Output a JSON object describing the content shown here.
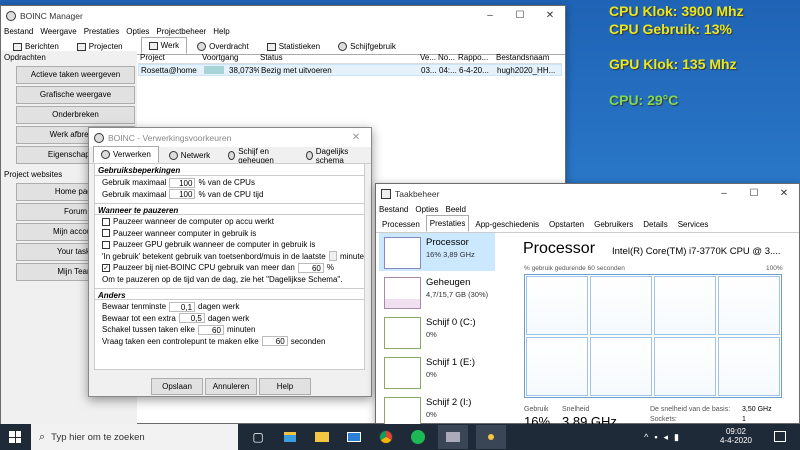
{
  "overlay": {
    "cpu_clock": "CPU Klok: 3900 Mhz",
    "cpu_usage": "CPU Gebruik: 13%",
    "gpu_clock": "GPU Klok: 135 Mhz",
    "cpu_temp": "CPU: 29°C"
  },
  "boinc": {
    "title": "BOINC Manager",
    "menu": [
      "Bestand",
      "Weergave",
      "Prestaties",
      "Opties",
      "Projectbeheer",
      "Help"
    ],
    "tabs": [
      "Berichten",
      "Projecten",
      "Werk",
      "Overdracht",
      "Statistieken",
      "Schijfgebruik"
    ],
    "side_opdrachten": "Opdrachten",
    "side_buttons": [
      "Actieve taken weergeven",
      "Grafische weergave",
      "Onderbreken",
      "Werk afbreken",
      "Eigenschappen"
    ],
    "side_projects": "Project websites",
    "side_links": [
      "Home page",
      "Forum",
      "Mijn account",
      "Your tasks",
      "Mijn Team"
    ],
    "columns": [
      "Project",
      "Voortgang",
      "Status",
      "Ve...",
      "No...",
      "Rappo...",
      "Bestandsnaam"
    ],
    "row": [
      "Rosetta@home",
      "38,073%",
      "Bezig met uitvoeren",
      "03...",
      "04:...",
      "6-4-20...",
      "hugh2020_HH..."
    ]
  },
  "prefs": {
    "title": "BOINC - Verwerkingsvoorkeuren",
    "tabs": [
      "Verwerken",
      "Netwerk",
      "Schijf en geheugen",
      "Dagelijks schema"
    ],
    "sec1": "Gebruiksbeperkingen",
    "l1a": "Gebruik maximaal",
    "v1": "100",
    "l1b": "% van de CPUs",
    "l2a": "Gebruik maximaal",
    "v2": "100",
    "l2b": "% van de CPU tijd",
    "sec2": "Wanneer te pauzeren",
    "c1": "Pauzeer wanneer de computer op accu werkt",
    "c2": "Pauzeer wanneer computer in gebruik is",
    "c3": "Pauzeer GPU gebruik wanneer de computer in gebruik is",
    "l3a": "'In gebruik' betekent gebruik van toetsenbord/muis in de laatste",
    "l3b": "minute",
    "c4": "Pauzeer bij niet-BOINC CPU gebruik van meer dan",
    "v4": "60",
    "l4b": "%",
    "l5": "Om te pauzeren op de tijd van de dag, zie het \"Dagelijkse Schema\".",
    "sec3": "Anders",
    "l6a": "Bewaar tenminste",
    "v6": "0,1",
    "l6b": "dagen werk",
    "l7a": "Bewaar tot een extra",
    "v7": "0,5",
    "l7b": "dagen werk",
    "l8a": "Schakel tussen taken elke",
    "v8": "60",
    "l8b": "minuten",
    "l9a": "Vraag taken een controlepunt te maken elke",
    "v9": "60",
    "l9b": "seconden",
    "btn_save": "Opslaan",
    "btn_cancel": "Annuleren",
    "btn_help": "Help"
  },
  "tm": {
    "title": "Taakbeheer",
    "menu": [
      "Bestand",
      "Opties",
      "Beeld"
    ],
    "tabs": [
      "Processen",
      "Prestaties",
      "App-geschiedenis",
      "Opstarten",
      "Gebruikers",
      "Details",
      "Services"
    ],
    "items": [
      {
        "name": "Processor",
        "sub": "16%  3,89 GHz"
      },
      {
        "name": "Geheugen",
        "sub": "4,7/15,7 GB (30%)"
      },
      {
        "name": "Schijf 0 (C:)",
        "sub": "0%"
      },
      {
        "name": "Schijf 1 (E:)",
        "sub": "0%"
      },
      {
        "name": "Schijf 2 (I:)",
        "sub": "0%"
      }
    ],
    "heading": "Processor",
    "cpu_model": "Intel(R) Core(TM) i7-3770K CPU @ 3....",
    "graph_label": "% gebruik gedurende 60 seconden",
    "graph_max": "100%",
    "stat_usage_label": "Gebruik",
    "stat_usage": "16%",
    "stat_speed_label": "Snelheid",
    "stat_speed": "3,89 GHz",
    "base_label": "De snelheid van de basis:",
    "base_val": "3,50 GHz",
    "sockets_label": "Sockets:",
    "sockets_val": "1"
  },
  "taskbar": {
    "search_placeholder": "Typ hier om te zoeken",
    "time": "09:02",
    "date": "4-4-2020"
  }
}
